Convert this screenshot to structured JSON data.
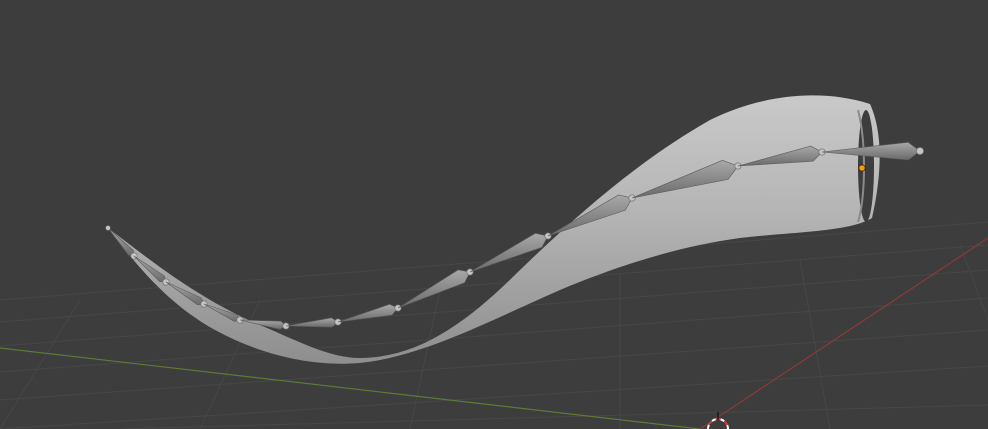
{
  "app": {
    "editor": "3D Viewport",
    "shading": "solid",
    "colors": {
      "background": "#3d3d3d",
      "grid_line": "#474747",
      "x_axis": "#8a3a3a",
      "y_axis": "#5e7a33",
      "mesh": "#b3b3b3",
      "bone": "#8f8f8f",
      "origin": "#f29a1a",
      "cursor": "#d83a3a"
    }
  },
  "scene": {
    "objects": [
      {
        "name_icon": "horn-mesh",
        "type": "mesh"
      },
      {
        "name_icon": "bone-chain",
        "type": "armature",
        "bone_count": 12
      }
    ],
    "has_3d_cursor": true,
    "has_origin_point": true
  }
}
